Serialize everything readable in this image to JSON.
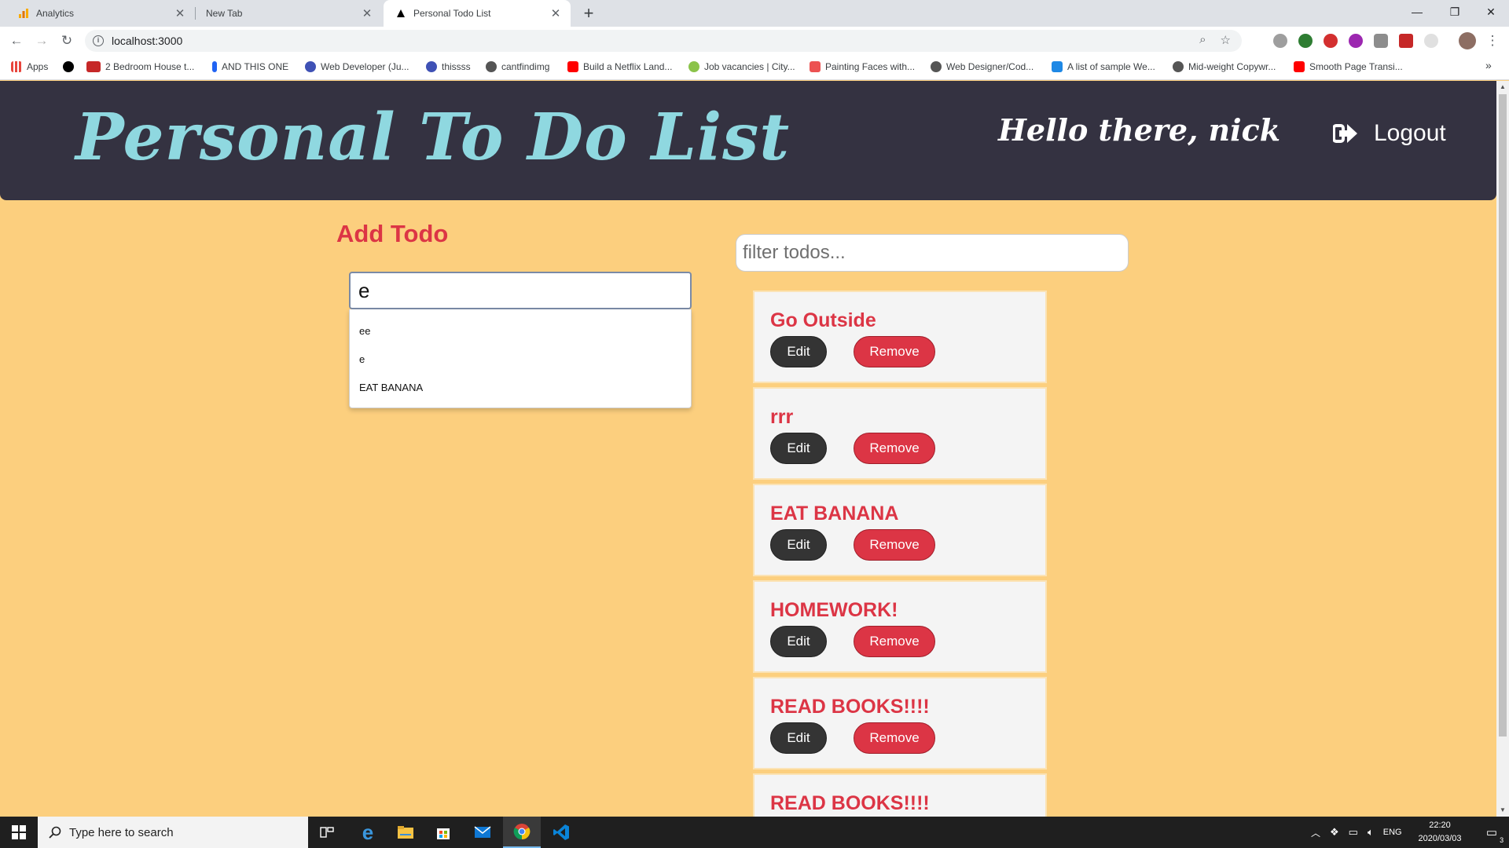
{
  "browser": {
    "tabs": [
      {
        "label": "Analytics",
        "active": false
      },
      {
        "label": "New Tab",
        "active": false
      },
      {
        "label": "Personal Todo List",
        "active": true
      }
    ],
    "url": "localhost:3000",
    "bookmarks": [
      "Apps",
      "2 Bedroom House t...",
      "AND THIS ONE",
      "Web Developer (Ju...",
      "thissss",
      "cantfindimg",
      "Build a Netflix Land...",
      "Job vacancies | City...",
      "Painting Faces with...",
      "Web Designer/Cod...",
      "A list of sample We...",
      "Mid-weight Copywr...",
      "Smooth Page Transi..."
    ],
    "bookmark_overflow": "»"
  },
  "app": {
    "title": "Personal To Do List",
    "greeting": "Hello there, nick",
    "logout_label": "Logout",
    "add_heading": "Add Todo",
    "add_input_value": "e",
    "autocomplete": [
      "ee",
      "e",
      "EAT BANANA"
    ],
    "filter_placeholder": "filter todos...",
    "edit_label": "Edit",
    "remove_label": "Remove",
    "todos": [
      "Go Outside",
      "rrr",
      "EAT BANANA",
      "HOMEWORK!",
      "READ BOOKS!!!!",
      "READ BOOKS!!!!"
    ],
    "colors": {
      "background": "#fccf7e",
      "header": "#343241",
      "title": "#8fd8e0",
      "accent_red": "#dc3545",
      "edit_button": "#343434"
    }
  },
  "taskbar": {
    "search_placeholder": "Type here to search",
    "language": "ENG",
    "time": "22:20",
    "date": "2020/03/03",
    "notification_count": "3"
  }
}
